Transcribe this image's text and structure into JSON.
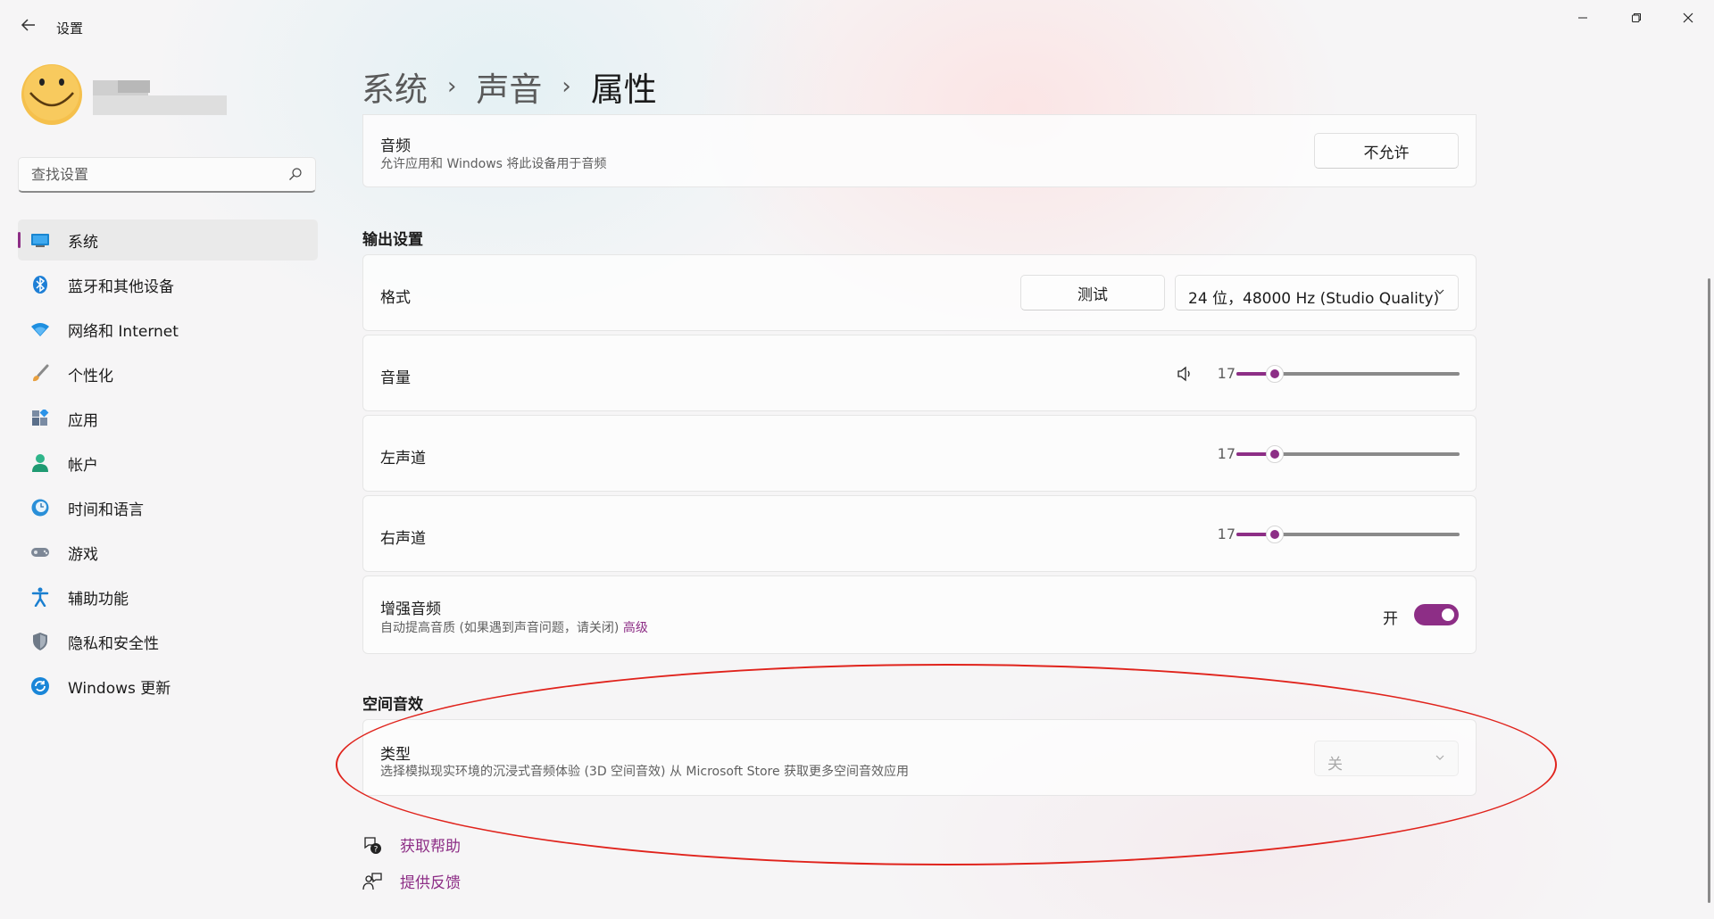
{
  "window": {
    "title": "设置",
    "controls": [
      "minimize",
      "restore",
      "close"
    ]
  },
  "search": {
    "placeholder": "查找设置"
  },
  "sidebar": {
    "items": [
      {
        "label": "系统",
        "icon": "monitor-icon",
        "active": true
      },
      {
        "label": "蓝牙和其他设备",
        "icon": "bluetooth-icon"
      },
      {
        "label": "网络和 Internet",
        "icon": "wifi-icon"
      },
      {
        "label": "个性化",
        "icon": "brush-icon"
      },
      {
        "label": "应用",
        "icon": "apps-icon"
      },
      {
        "label": "帐户",
        "icon": "person-icon"
      },
      {
        "label": "时间和语言",
        "icon": "clock-globe-icon"
      },
      {
        "label": "游戏",
        "icon": "gamepad-icon"
      },
      {
        "label": "辅助功能",
        "icon": "accessibility-icon"
      },
      {
        "label": "隐私和安全性",
        "icon": "shield-icon"
      },
      {
        "label": "Windows 更新",
        "icon": "update-icon"
      }
    ]
  },
  "breadcrumb": {
    "parent1": "系统",
    "parent2": "声音",
    "current": "属性"
  },
  "audio": {
    "title": "音频",
    "subtitle": "允许应用和 Windows 将此设备用于音频",
    "button": "不允许"
  },
  "output": {
    "section_title": "输出设置",
    "format": {
      "label": "格式",
      "test_button": "测试",
      "value": "24 位，48000 Hz (Studio Quality)"
    },
    "volume": {
      "label": "音量",
      "value": "17",
      "level": 17
    },
    "left": {
      "label": "左声道",
      "value": "17",
      "level": 17
    },
    "right": {
      "label": "右声道",
      "value": "17",
      "level": 17
    },
    "enhance": {
      "title": "增强音频",
      "subtitle": "自动提高音质 (如果遇到声音问题，请关闭)",
      "link": "高级",
      "toggle_label": "开",
      "toggle_on": true
    }
  },
  "spatial": {
    "section_title": "空间音效",
    "type_title": "类型",
    "type_subtitle": "选择模拟现实环境的沉浸式音频体验 (3D 空间音效)",
    "type_subtitle_link": "从 Microsoft Store 获取更多空间音效应用",
    "value": "关",
    "enabled": false
  },
  "help": {
    "get_help": "获取帮助",
    "feedback": "提供反馈"
  },
  "colors": {
    "accent": "#8d2e86",
    "annotation": "#e0231c"
  }
}
